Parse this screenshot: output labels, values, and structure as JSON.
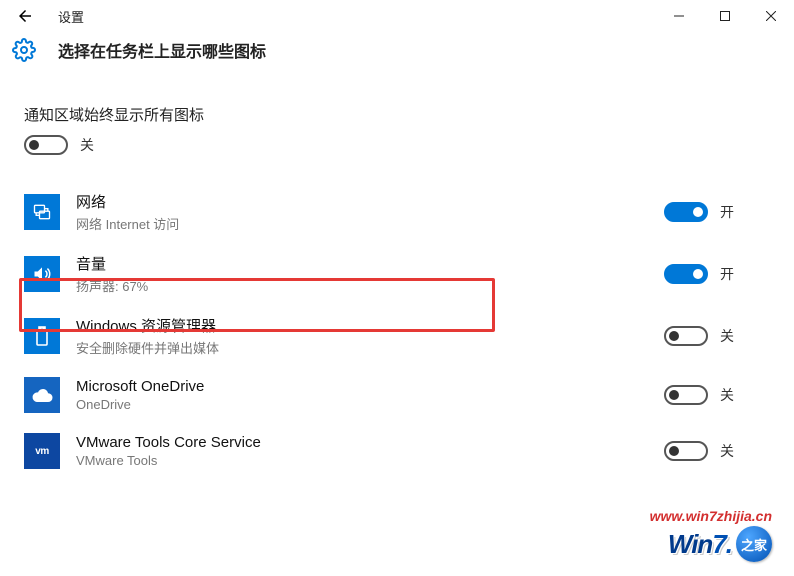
{
  "window": {
    "title": "设置",
    "page_title": "选择在任务栏上显示哪些图标"
  },
  "all_icons": {
    "label": "通知区域始终显示所有图标",
    "state": false,
    "state_text": "关"
  },
  "items": [
    {
      "icon": "network",
      "title": "网络",
      "subtitle": "网络 Internet 访问",
      "state": true,
      "state_text": "开"
    },
    {
      "icon": "volume",
      "title": "音量",
      "subtitle": "扬声器: 67%",
      "state": true,
      "state_text": "开"
    },
    {
      "icon": "explorer",
      "title": "Windows 资源管理器",
      "subtitle": "安全删除硬件并弹出媒体",
      "state": false,
      "state_text": "关",
      "highlighted": true
    },
    {
      "icon": "onedrive",
      "title": "Microsoft OneDrive",
      "subtitle": "OneDrive",
      "state": false,
      "state_text": "关"
    },
    {
      "icon": "vmware",
      "title": "VMware Tools Core Service",
      "subtitle": "VMware Tools",
      "state": false,
      "state_text": "关"
    }
  ],
  "watermark": {
    "url": "www.win7zhijia.cn",
    "logo_text_1": "Win",
    "logo_text_2": "7.",
    "logo_badge": "之家"
  }
}
